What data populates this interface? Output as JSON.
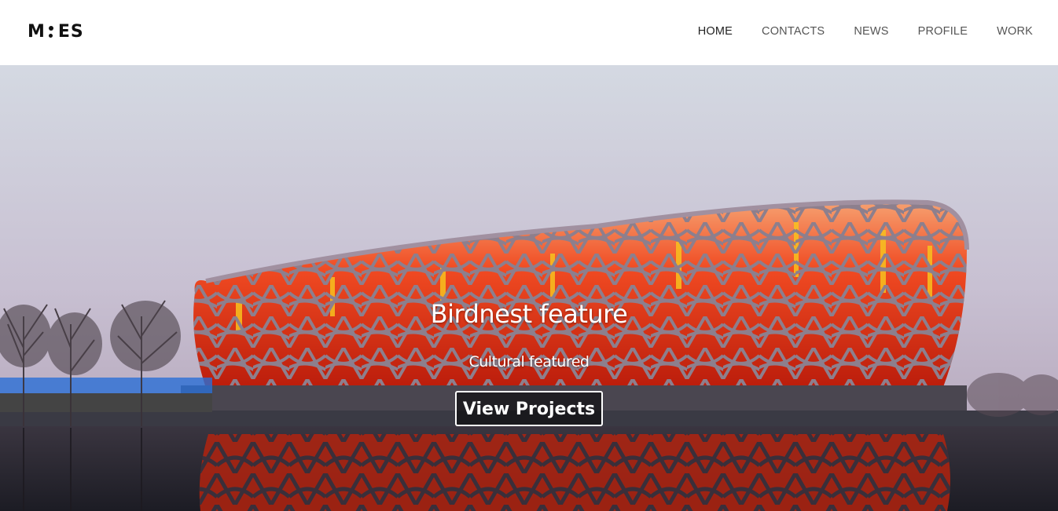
{
  "header": {
    "logo": {
      "left": "M",
      "right": "ES"
    },
    "nav": [
      {
        "label": "HOME",
        "active": true
      },
      {
        "label": "CONTACTS",
        "active": false
      },
      {
        "label": "NEWS",
        "active": false
      },
      {
        "label": "PROFILE",
        "active": false
      },
      {
        "label": "WORK",
        "active": false
      }
    ]
  },
  "hero": {
    "title": "Birdnest feature",
    "subtitle": "Cultural featured",
    "button_label": "View Projects"
  },
  "colors": {
    "sky_top": "#cfd4df",
    "sky_bottom": "#c9bccf",
    "stadium_glow": "#e8321a",
    "stadium_lattice": "#8c7d8c",
    "water": "#2a2a34",
    "nav_text": "#555555"
  }
}
